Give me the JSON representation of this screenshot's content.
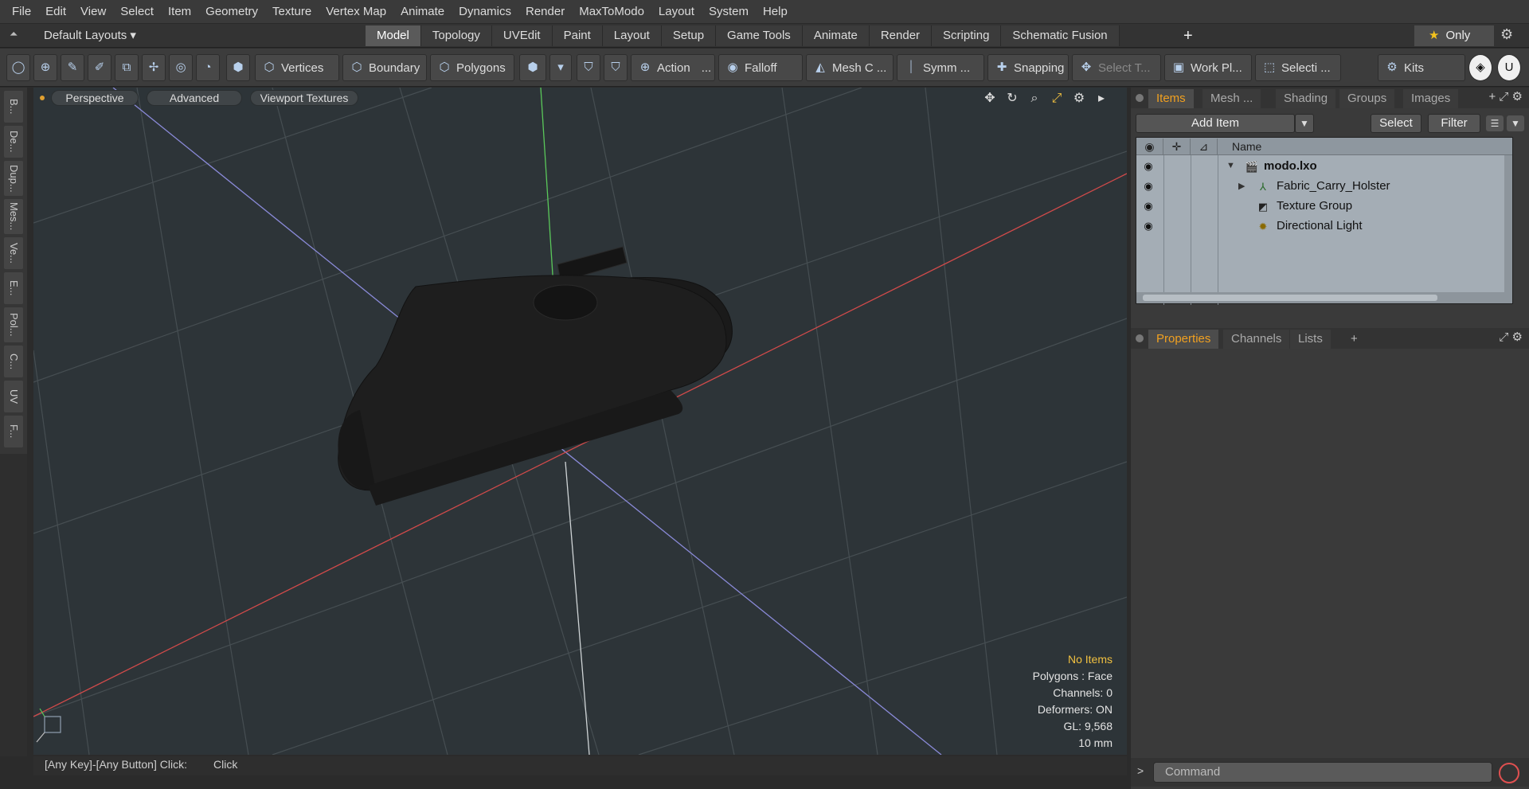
{
  "menu": [
    "File",
    "Edit",
    "View",
    "Select",
    "Item",
    "Geometry",
    "Texture",
    "Vertex Map",
    "Animate",
    "Dynamics",
    "Render",
    "MaxToModo",
    "Layout",
    "System",
    "Help"
  ],
  "layout_selector": "Default Layouts ▾",
  "layout_tabs": [
    {
      "label": "Model",
      "active": true
    },
    {
      "label": "Topology"
    },
    {
      "label": "UVEdit"
    },
    {
      "label": "Paint"
    },
    {
      "label": "Layout"
    },
    {
      "label": "Setup"
    },
    {
      "label": "Game Tools"
    },
    {
      "label": "Animate"
    },
    {
      "label": "Render"
    },
    {
      "label": "Scripting"
    },
    {
      "label": "Schematic Fusion"
    }
  ],
  "tab_plus": "+",
  "only_label": "Only",
  "toolbar": {
    "vertices": "Vertices",
    "boundary": "Boundary",
    "polygons": "Polygons",
    "action": "Action",
    "action_more": "...",
    "falloff": "Falloff",
    "mesh": "Mesh C ...",
    "symm": "Symm ...",
    "snapping": "Snapping",
    "select_t": "Select T...",
    "work_plane": "Work Pl...",
    "selection": "Selecti ...",
    "kits": "Kits"
  },
  "left_tabs": [
    "B...",
    "De...",
    "Dup...",
    "Mes...",
    "Ve...",
    "E...",
    "Pol...",
    "C...",
    "UV",
    "F..."
  ],
  "viewport": {
    "view_mode": "Perspective",
    "advanced": "Advanced",
    "textures": "Viewport Textures",
    "info": {
      "selection": "No Items",
      "polygons": "Polygons : Face",
      "channels": "Channels: 0",
      "deformers": "Deformers: ON",
      "gl": "GL: 9,568",
      "unit": "10 mm"
    }
  },
  "status": {
    "hint": "[Any Key]-[Any Button] Click:",
    "action": "Click"
  },
  "items_panel": {
    "tabs": [
      {
        "label": "Items",
        "active": true
      },
      {
        "label": "Mesh ..."
      },
      {
        "label": "Shading"
      },
      {
        "label": "Groups"
      },
      {
        "label": "Images"
      }
    ],
    "add_item": "Add Item",
    "select": "Select",
    "filter": "Filter",
    "col_name": "Name",
    "rows": [
      {
        "label": "modo.lxo",
        "indent": 0
      },
      {
        "label": "Fabric_Carry_Holster",
        "indent": 1
      },
      {
        "label": "Texture Group",
        "indent": 1
      },
      {
        "label": "Directional Light",
        "indent": 1
      }
    ]
  },
  "props_panel": {
    "tabs": [
      {
        "label": "Properties",
        "active": true
      },
      {
        "label": "Channels"
      },
      {
        "label": "Lists"
      }
    ],
    "plus": "+"
  },
  "command": {
    "arrow": ">",
    "placeholder": "Command"
  }
}
